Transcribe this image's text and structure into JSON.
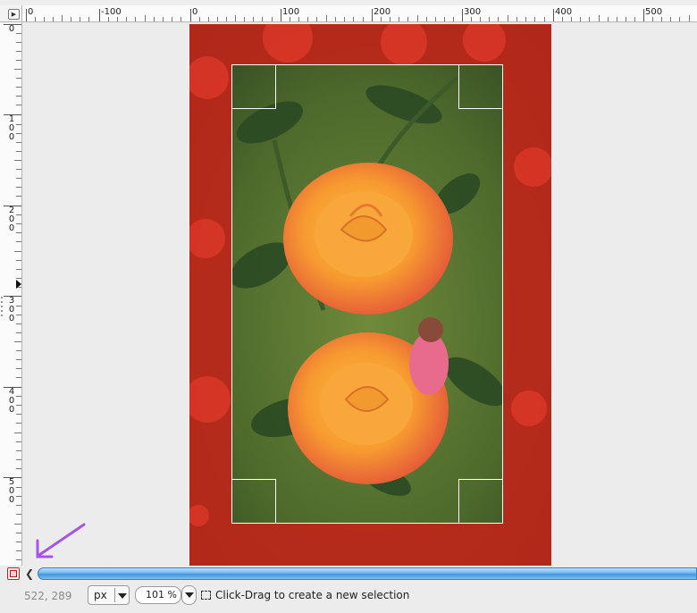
{
  "rulers": {
    "horizontal_labels": [
      "0",
      "-100",
      "0",
      "100",
      "200",
      "300",
      "400",
      "500"
    ],
    "vertical_labels": [
      [
        "0"
      ],
      [
        "1",
        "0",
        "0"
      ],
      [
        "2",
        "0",
        "0"
      ],
      [
        "3",
        "0",
        "0"
      ],
      [
        "4",
        "0",
        "0"
      ],
      [
        "5",
        "0",
        "0"
      ]
    ]
  },
  "status": {
    "pointer_coords": "522, 289",
    "unit": "px",
    "zoom": "101 %",
    "hint": "Click-Drag to create a new selection"
  },
  "colors": {
    "annotation_arrow": "#a655e6",
    "scrollbar": "#4a9fe2",
    "quickmask": "#c81e1e",
    "outside_mask": "#c0251a"
  },
  "icons": {
    "navigate": "navigate-triangle-icon",
    "quickmask": "quick-mask-toggle-icon",
    "scroll_left": "chevron-left-icon",
    "hint": "rect-select-icon"
  }
}
